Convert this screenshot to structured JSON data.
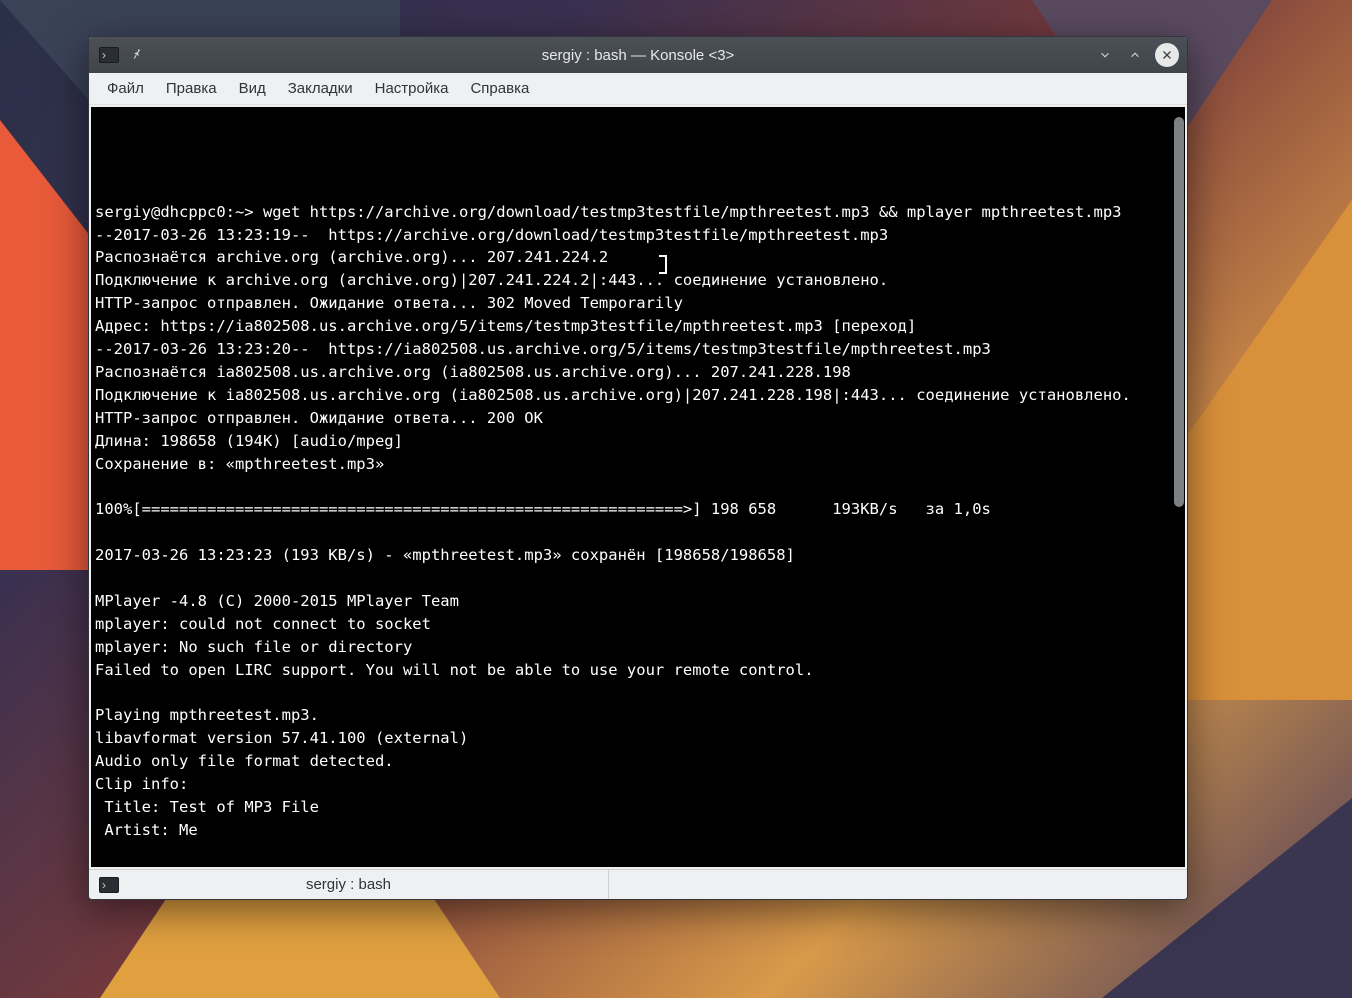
{
  "window": {
    "title": "sergiy : bash — Konsole <3>"
  },
  "menu": {
    "file": "Файл",
    "edit": "Правка",
    "view": "Вид",
    "bookmarks": "Закладки",
    "settings": "Настройка",
    "help": "Справка"
  },
  "tab": {
    "label": "sergiy : bash"
  },
  "terminal": {
    "lines": [
      "",
      "",
      "sergiy@dhcppc0:~> wget https://archive.org/download/testmp3testfile/mpthreetest.mp3 && mplayer mpthreetest.mp3",
      "--2017-03-26 13:23:19--  https://archive.org/download/testmp3testfile/mpthreetest.mp3",
      "Распознаётся archive.org (archive.org)... 207.241.224.2",
      "Подключение к archive.org (archive.org)|207.241.224.2|:443... соединение установлено.",
      "HTTP-запрос отправлен. Ожидание ответа... 302 Moved Temporarily",
      "Адрес: https://ia802508.us.archive.org/5/items/testmp3testfile/mpthreetest.mp3 [переход]",
      "--2017-03-26 13:23:20--  https://ia802508.us.archive.org/5/items/testmp3testfile/mpthreetest.mp3",
      "Распознаётся ia802508.us.archive.org (ia802508.us.archive.org)... 207.241.228.198",
      "Подключение к ia802508.us.archive.org (ia802508.us.archive.org)|207.241.228.198|:443... соединение установлено.",
      "HTTP-запрос отправлен. Ожидание ответа... 200 OK",
      "Длина: 198658 (194K) [audio/mpeg]",
      "Сохранение в: «mpthreetest.mp3»",
      "",
      "100%[==========================================================>] 198 658      193KB/s   за 1,0s   ",
      "",
      "2017-03-26 13:23:23 (193 KB/s) - «mpthreetest.mp3» сохранён [198658/198658]",
      "",
      "MPlayer -4.8 (C) 2000-2015 MPlayer Team",
      "mplayer: could not connect to socket",
      "mplayer: No such file or directory",
      "Failed to open LIRC support. You will not be able to use your remote control.",
      "",
      "Playing mpthreetest.mp3.",
      "libavformat version 57.41.100 (external)",
      "Audio only file format detected.",
      "Clip info:",
      " Title: Test of MP3 File",
      " Artist: Me"
    ]
  }
}
